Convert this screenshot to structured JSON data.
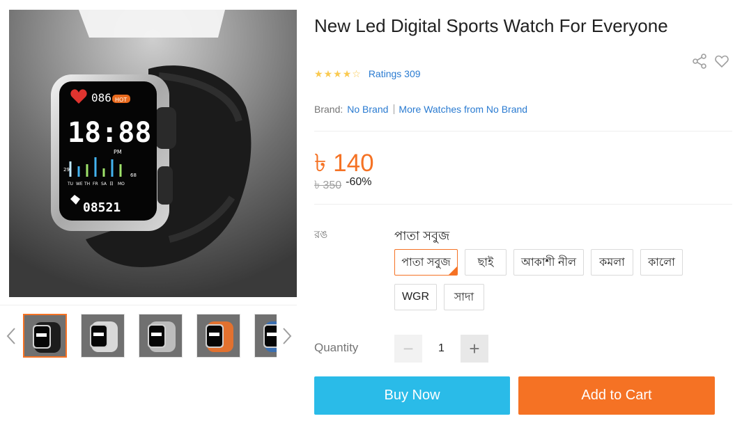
{
  "product": {
    "title": "New Led Digital Sports Watch For Everyone",
    "ratings_text": "Ratings 309",
    "star_count": 4.5
  },
  "brand": {
    "label": "Brand:",
    "name": "No Brand",
    "more_link": "More Watches from No Brand"
  },
  "price": {
    "current": "৳ 140",
    "original": "৳ 350",
    "discount": "-60%"
  },
  "variants": {
    "label": "রঙ",
    "selected": "পাতা সবুজ",
    "options": [
      "পাতা সবুজ",
      "ছাই",
      "আকাশী নীল",
      "কমলা",
      "কালো",
      "WGR",
      "সাদা"
    ]
  },
  "watch_display": {
    "heart_rate": "086",
    "hot_badge": "HOT",
    "time": "18:88",
    "ampm": "PM",
    "days": [
      "TU",
      "WE",
      "TH",
      "FR",
      "SA",
      "日",
      "MO"
    ],
    "side_left": "29",
    "side_right": "68",
    "steps": "08521"
  },
  "quantity": {
    "label": "Quantity",
    "value": "1",
    "minus": "−",
    "plus": "+"
  },
  "actions": {
    "buy_now": "Buy Now",
    "add_to_cart": "Add to Cart"
  },
  "colors": {
    "accent": "#f57224",
    "buy_now": "#2abbe8",
    "link": "#2a7bd1",
    "star": "#faca51",
    "thumb_variants": [
      "#1c1c1c",
      "#d8d8d8",
      "#bcbcbc",
      "#e2712f",
      "#3b6fb0"
    ]
  }
}
